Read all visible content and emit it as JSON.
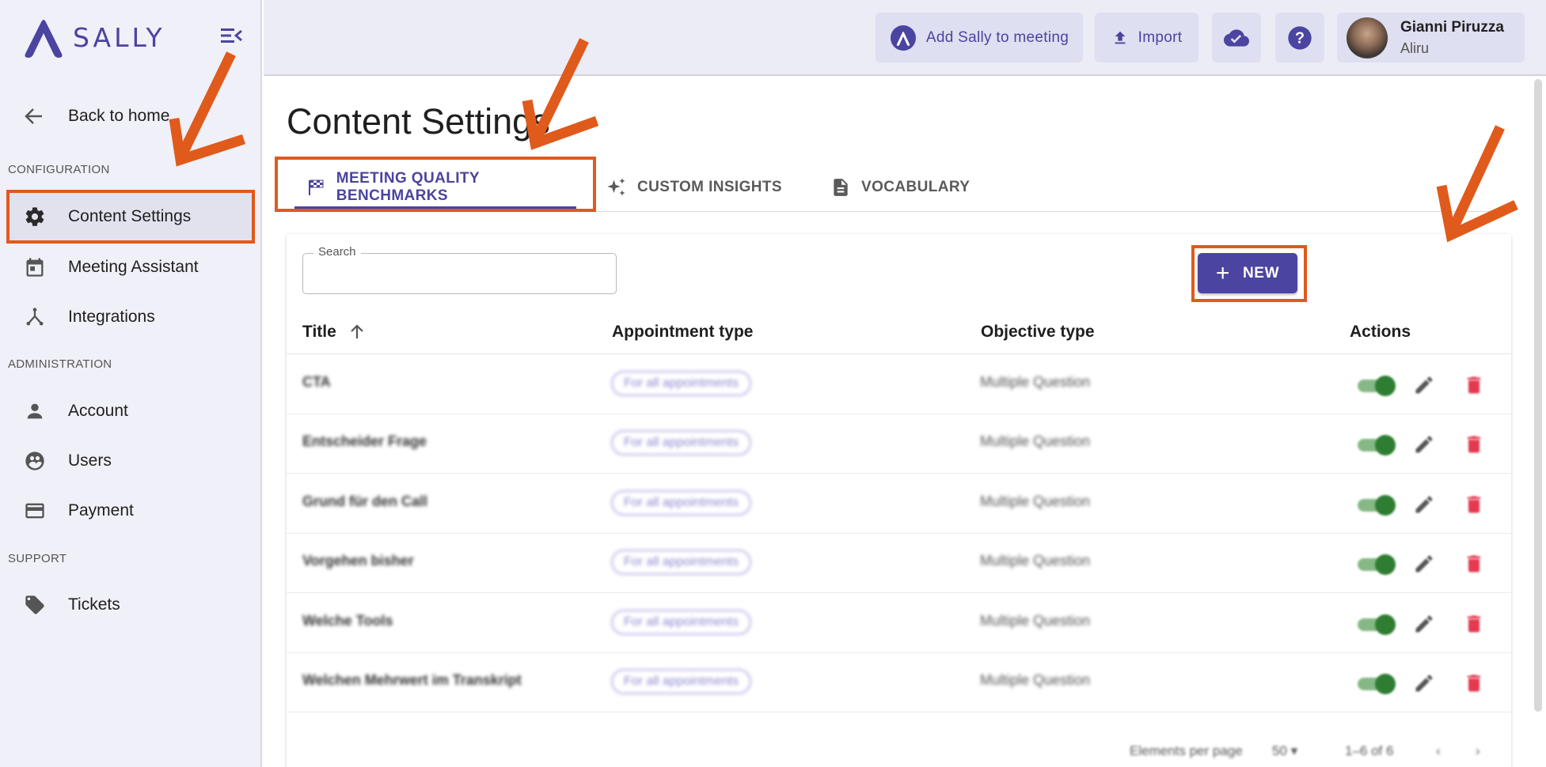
{
  "logo": {
    "text": "SALLY"
  },
  "sidebar": {
    "back_label": "Back to home",
    "sections": {
      "configuration": "CONFIGURATION",
      "administration": "ADMINISTRATION",
      "support": "SUPPORT"
    },
    "items": [
      {
        "label": "Content Settings",
        "icon": "gear-icon",
        "active": true
      },
      {
        "label": "Meeting Assistant",
        "icon": "calendar-icon"
      },
      {
        "label": "Integrations",
        "icon": "integrations-icon"
      },
      {
        "label": "Account",
        "icon": "person-icon"
      },
      {
        "label": "Users",
        "icon": "users-icon"
      },
      {
        "label": "Payment",
        "icon": "credit-card-icon"
      },
      {
        "label": "Tickets",
        "icon": "tag-icon"
      }
    ]
  },
  "header": {
    "add_sally_label": "Add Sally to meeting",
    "import_label": "Import",
    "user_name": "Gianni Piruzza",
    "user_org": "Aliru"
  },
  "main": {
    "title": "Content Settings",
    "tabs": [
      {
        "label": "MEETING QUALITY BENCHMARKS",
        "icon": "checkered-flag-icon",
        "active": true
      },
      {
        "label": "CUSTOM INSIGHTS",
        "icon": "sparkle-icon"
      },
      {
        "label": "VOCABULARY",
        "icon": "document-icon"
      }
    ],
    "search_label": "Search",
    "search_value": "",
    "new_label": "NEW",
    "columns": {
      "title": "Title",
      "appointment": "Appointment type",
      "objective": "Objective type",
      "actions": "Actions"
    },
    "rows": [
      {
        "title": "CTA",
        "appointment": "For all appointments",
        "objective": "Multiple Question",
        "enabled": true
      },
      {
        "title": "Entscheider Frage",
        "appointment": "For all appointments",
        "objective": "Multiple Question",
        "enabled": true
      },
      {
        "title": "Grund für den Call",
        "appointment": "For all appointments",
        "objective": "Multiple Question",
        "enabled": true
      },
      {
        "title": "Vorgehen bisher",
        "appointment": "For all appointments",
        "objective": "Multiple Question",
        "enabled": true
      },
      {
        "title": "Welche Tools",
        "appointment": "For all appointments",
        "objective": "Multiple Question",
        "enabled": true
      },
      {
        "title": "Welchen Mehrwert im Transkript",
        "appointment": "For all appointments",
        "objective": "Multiple Question",
        "enabled": true
      }
    ],
    "pagination": {
      "per_page_label": "Elements per page",
      "per_page_value": "50",
      "range": "1–6 of 6"
    }
  },
  "colors": {
    "brand": "#4b44a0",
    "annotation": "#e05a1c",
    "toggle_on": "#2e7d32",
    "delete": "#e53950"
  }
}
